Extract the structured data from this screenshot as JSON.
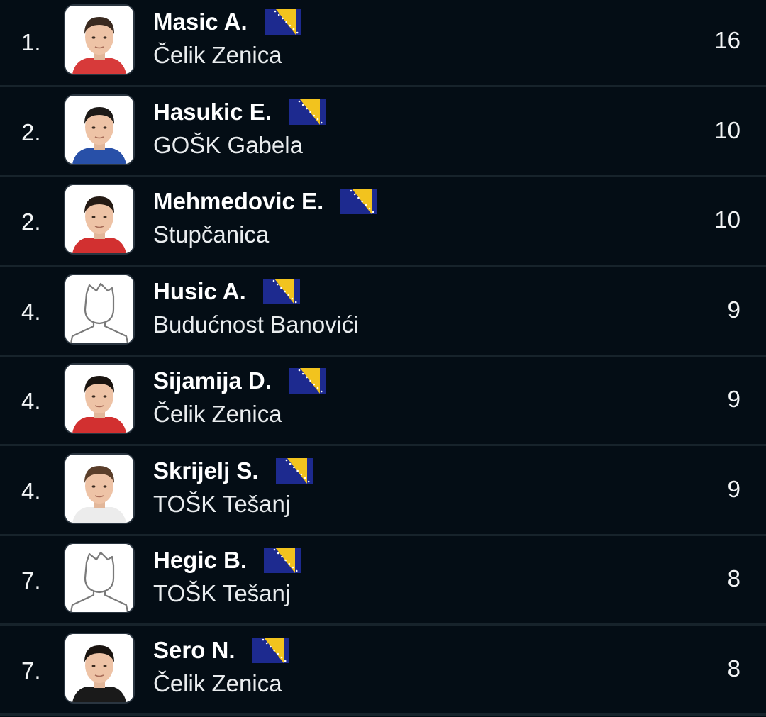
{
  "colors": {
    "background": "#040d15",
    "divider": "#17232b",
    "flag_blue": "#1d2a8f",
    "flag_yellow": "#f2c31e"
  },
  "icons": {
    "flag": "bosnia-herzegovina-flag-icon",
    "placeholder_avatar": "player-placeholder-icon"
  },
  "rows": [
    {
      "rank": "1.",
      "name": "Masic A.",
      "team": "Čelik Zenica",
      "value": "16",
      "photo": "face",
      "shirt": "#d73a3a",
      "hair": "#3a2a20"
    },
    {
      "rank": "2.",
      "name": "Hasukic E.",
      "team": "GOŠK Gabela",
      "value": "10",
      "photo": "face",
      "shirt": "#2850a8",
      "hair": "#1d1a18"
    },
    {
      "rank": "2.",
      "name": "Mehmedovic E.",
      "team": "Stupčanica",
      "value": "10",
      "photo": "face",
      "shirt": "#d23030",
      "hair": "#241a14"
    },
    {
      "rank": "4.",
      "name": "Husic A.",
      "team": "Budućnost Banovići",
      "value": "9",
      "photo": "placeholder"
    },
    {
      "rank": "4.",
      "name": "Sijamija D.",
      "team": "Čelik Zenica",
      "value": "9",
      "photo": "face",
      "shirt": "#d23030",
      "hair": "#1a1410"
    },
    {
      "rank": "4.",
      "name": "Skrijelj S.",
      "team": "TOŠK Tešanj",
      "value": "9",
      "photo": "face",
      "shirt": "#ececec",
      "hair": "#5a3e2a"
    },
    {
      "rank": "7.",
      "name": "Hegic B.",
      "team": "TOŠK Tešanj",
      "value": "8",
      "photo": "placeholder"
    },
    {
      "rank": "7.",
      "name": "Sero N.",
      "team": "Čelik Zenica",
      "value": "8",
      "photo": "face",
      "shirt": "#1a1a1a",
      "hair": "#1a1410"
    }
  ]
}
